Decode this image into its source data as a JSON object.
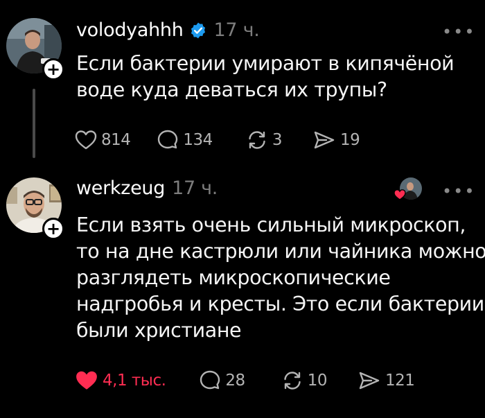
{
  "posts": [
    {
      "username": "volodyahhh",
      "time": "17 ч.",
      "verified": true,
      "more": "•••",
      "follow_icon": "plus-icon",
      "text_lines": [
        "Если бактерии умирают в кипячёной",
        "воде куда деваться их трупы?"
      ],
      "stats": {
        "likes": "814",
        "comments": "134",
        "reposts": "3",
        "shares": "19"
      }
    },
    {
      "username": "werkzeug",
      "time": "17 ч.",
      "verified": false,
      "more": "•••",
      "follow_icon": "plus-icon",
      "text_lines": [
        "Если взять очень сильный микроскоп,",
        "то на дне кастрюли или чайника можно",
        "разглядеть микроскопические",
        "надгробья и кресты. Это если бактерии",
        "были христиане"
      ],
      "stats": {
        "likes": "4,1 тыс.",
        "comments": "28",
        "reposts": "10",
        "shares": "121"
      },
      "liked": true,
      "liked_by_author": true
    }
  ],
  "colors": {
    "background": "#000000",
    "verified_badge": "#1d9bf0",
    "like_active": "#ff2d52",
    "muted": "#7d7d7d"
  }
}
